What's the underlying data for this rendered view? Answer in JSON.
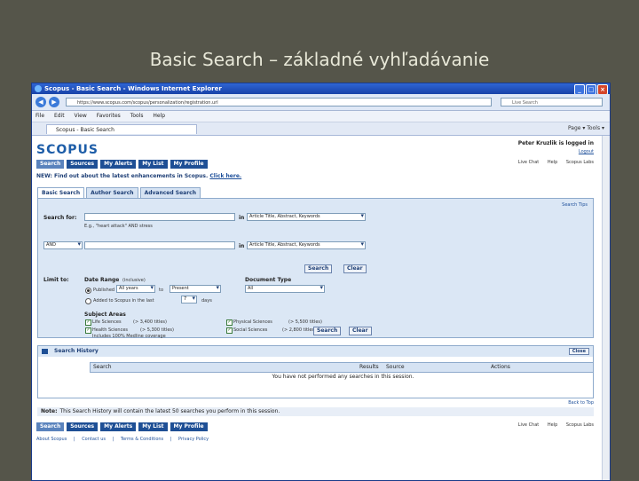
{
  "slide_title": "Basic Search – základné vyhľadávanie",
  "window": {
    "title": "Scopus - Basic Search - Windows Internet Explorer"
  },
  "browser": {
    "url": "https://www.scopus.com/scopus/personalization/registration.url",
    "live_search_placeholder": "Live Search",
    "menu": [
      "File",
      "Edit",
      "View",
      "Favorites",
      "Tools",
      "Help"
    ],
    "tab_label": "Scopus - Basic Search",
    "tools_text": "Page ▾  Tools ▾"
  },
  "header": {
    "logo": "SCOPUS",
    "logged_in": "Peter Kruzlik is logged in",
    "logout": "Logout",
    "nav": [
      "Search",
      "Sources",
      "My Alerts",
      "My List",
      "My Profile"
    ],
    "help_links": [
      "Live Chat",
      "Help",
      "Scopus Labs"
    ]
  },
  "news": {
    "text": "NEW: Find out about the latest enhancements in Scopus.",
    "link": "Click here."
  },
  "search_tabs": [
    "Basic Search",
    "Author Search",
    "Advanced Search"
  ],
  "search_form": {
    "search_tips": "Search Tips",
    "search_for_label": "Search for:",
    "in_label": "in",
    "field_1": "Article Title, Abstract, Keywords",
    "example": "E.g., \"heart attack\" AND stress",
    "operator": "AND",
    "field_2": "Article Title, Abstract, Keywords",
    "search_btn": "Search",
    "clear_btn": "Clear",
    "limit_to": "Limit to:",
    "date_range": "Date Range",
    "inclusive": "(inclusive)",
    "published": "Published",
    "years_from": "All years",
    "to": "to",
    "years_to": "Present",
    "added_to_scopus": "Added to Scopus in the last",
    "days_value": "7",
    "days": "days",
    "document_type": "Document Type",
    "doc_type_value": "All",
    "subject_areas": "Subject Areas",
    "life_sciences": "Life Sciences",
    "life_count": "(> 3,400 titles)",
    "health_sciences": "Health Sciences",
    "health_count": "(> 5,300 titles)",
    "health_note": "Includes 100% Medline coverage",
    "physical_sciences": "Physical Sciences",
    "physical_count": "(> 5,500 titles)",
    "social_sciences": "Social Sciences",
    "social_count": "(> 2,800 titles)"
  },
  "history": {
    "title": "Search History",
    "close": "Close",
    "columns": [
      "Search",
      "Results",
      "Source",
      "Actions"
    ],
    "empty": "You have not performed any searches in this session.",
    "back_to_top": "Back to Top"
  },
  "note": {
    "label": "Note:",
    "text": "This Search History will contain the latest 50 searches you perform in this session."
  },
  "footer": {
    "nav": [
      "Search",
      "Sources",
      "My Alerts",
      "My List",
      "My Profile"
    ],
    "links": [
      "About Scopus",
      "|",
      "Contact us",
      "|",
      "Terms & Conditions",
      "|",
      "Privacy Policy"
    ],
    "help_links": [
      "Live Chat",
      "Help",
      "Scopus Labs"
    ]
  }
}
